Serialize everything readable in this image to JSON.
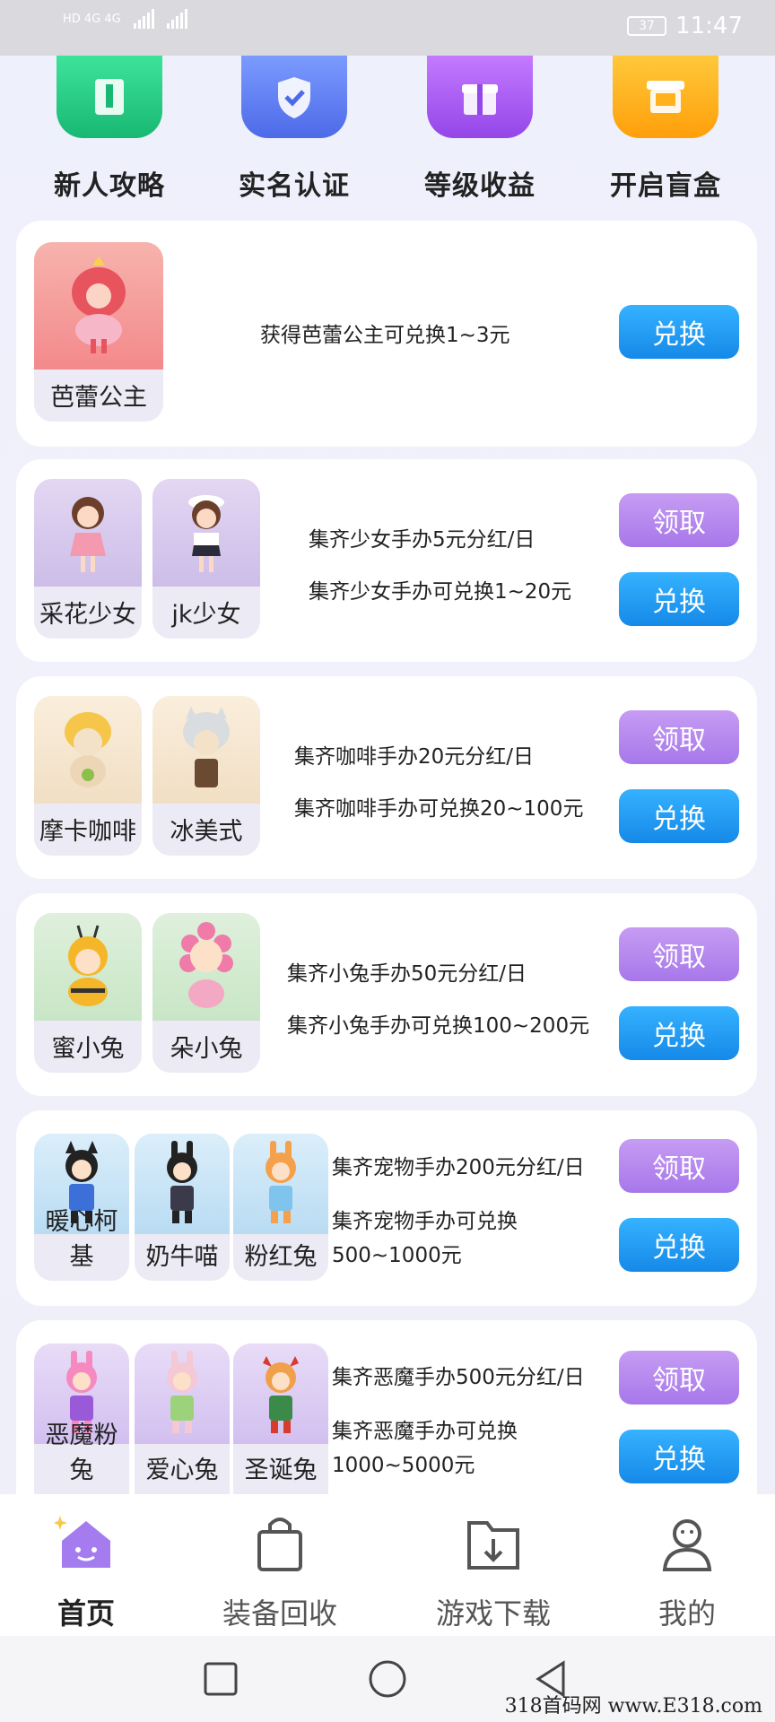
{
  "status_bar": {
    "left_text": "HD 4G 4G",
    "battery": "37",
    "time": "11:47"
  },
  "top_icons": [
    {
      "label": "新人攻略",
      "icon": "book-icon",
      "color": "#2ccf86"
    },
    {
      "label": "实名认证",
      "icon": "shield-check-icon",
      "color": "#5b7cf0"
    },
    {
      "label": "等级收益",
      "icon": "gift-icon",
      "color": "#a85bf0"
    },
    {
      "label": "开启盲盒",
      "icon": "box-icon",
      "color": "#ffb21e"
    }
  ],
  "cards": [
    {
      "figures": [
        {
          "name": "芭蕾公主"
        }
      ],
      "desc": [
        "获得芭蕾公主可兑换1~3元"
      ],
      "buttons": {
        "exchange": "兑换"
      }
    },
    {
      "figures": [
        {
          "name": "采花少女"
        },
        {
          "name": "jk少女"
        }
      ],
      "desc": [
        "集齐少女手办5元分红/日",
        "集齐少女手办可兑换1~20元"
      ],
      "buttons": {
        "claim": "领取",
        "exchange": "兑换"
      }
    },
    {
      "figures": [
        {
          "name": "摩卡咖啡"
        },
        {
          "name": "冰美式"
        }
      ],
      "desc": [
        "集齐咖啡手办20元分红/日",
        "集齐咖啡手办可兑换20~100元"
      ],
      "buttons": {
        "claim": "领取",
        "exchange": "兑换"
      }
    },
    {
      "figures": [
        {
          "name": "蜜小兔"
        },
        {
          "name": "朵小兔"
        }
      ],
      "desc": [
        "集齐小兔手办50元分红/日",
        "集齐小兔手办可兑换100~200元"
      ],
      "buttons": {
        "claim": "领取",
        "exchange": "兑换"
      }
    },
    {
      "figures": [
        {
          "name": "暖心柯基"
        },
        {
          "name": "奶牛喵"
        },
        {
          "name": "粉红兔"
        }
      ],
      "desc": [
        "集齐宠物手办200元分红/日",
        "集齐宠物手办可兑换",
        "500~1000元"
      ],
      "buttons": {
        "claim": "领取",
        "exchange": "兑换"
      }
    },
    {
      "figures": [
        {
          "name": "恶魔粉兔"
        },
        {
          "name": "爱心兔"
        },
        {
          "name": "圣诞兔"
        }
      ],
      "desc": [
        "集齐恶魔手办500元分红/日",
        "集齐恶魔手办可兑换",
        "1000~5000元"
      ],
      "buttons": {
        "claim": "领取",
        "exchange": "兑换"
      }
    }
  ],
  "bottom_nav": [
    {
      "label": "首页",
      "icon": "home-icon",
      "active": true
    },
    {
      "label": "装备回收",
      "icon": "shopping-bag-icon"
    },
    {
      "label": "游戏下载",
      "icon": "download-folder-icon"
    },
    {
      "label": "我的",
      "icon": "user-icon"
    }
  ],
  "watermark": "318首码网 www.E318.com"
}
